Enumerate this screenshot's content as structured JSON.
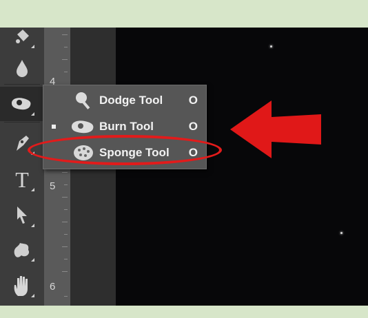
{
  "toolbar": {
    "tools": [
      {
        "name": "paint-bucket-icon"
      },
      {
        "name": "blur-drop-icon"
      },
      {
        "name": "burn-hand-icon",
        "active": true
      },
      {
        "name": "pen-icon"
      },
      {
        "name": "type-icon",
        "glyph": "T"
      },
      {
        "name": "path-selection-arrow-icon"
      },
      {
        "name": "custom-shape-icon"
      },
      {
        "name": "hand-icon"
      }
    ]
  },
  "ruler": {
    "labels": [
      "4",
      "5",
      "6"
    ]
  },
  "flyout": {
    "items": [
      {
        "label": "Dodge Tool",
        "shortcut": "O",
        "icon": "dodge-icon",
        "selected": false
      },
      {
        "label": "Burn Tool",
        "shortcut": "O",
        "icon": "burn-icon",
        "selected": true
      },
      {
        "label": "Sponge Tool",
        "shortcut": "O",
        "icon": "sponge-icon",
        "selected": false
      }
    ]
  },
  "annotation": {
    "color": "#e21b1b"
  }
}
